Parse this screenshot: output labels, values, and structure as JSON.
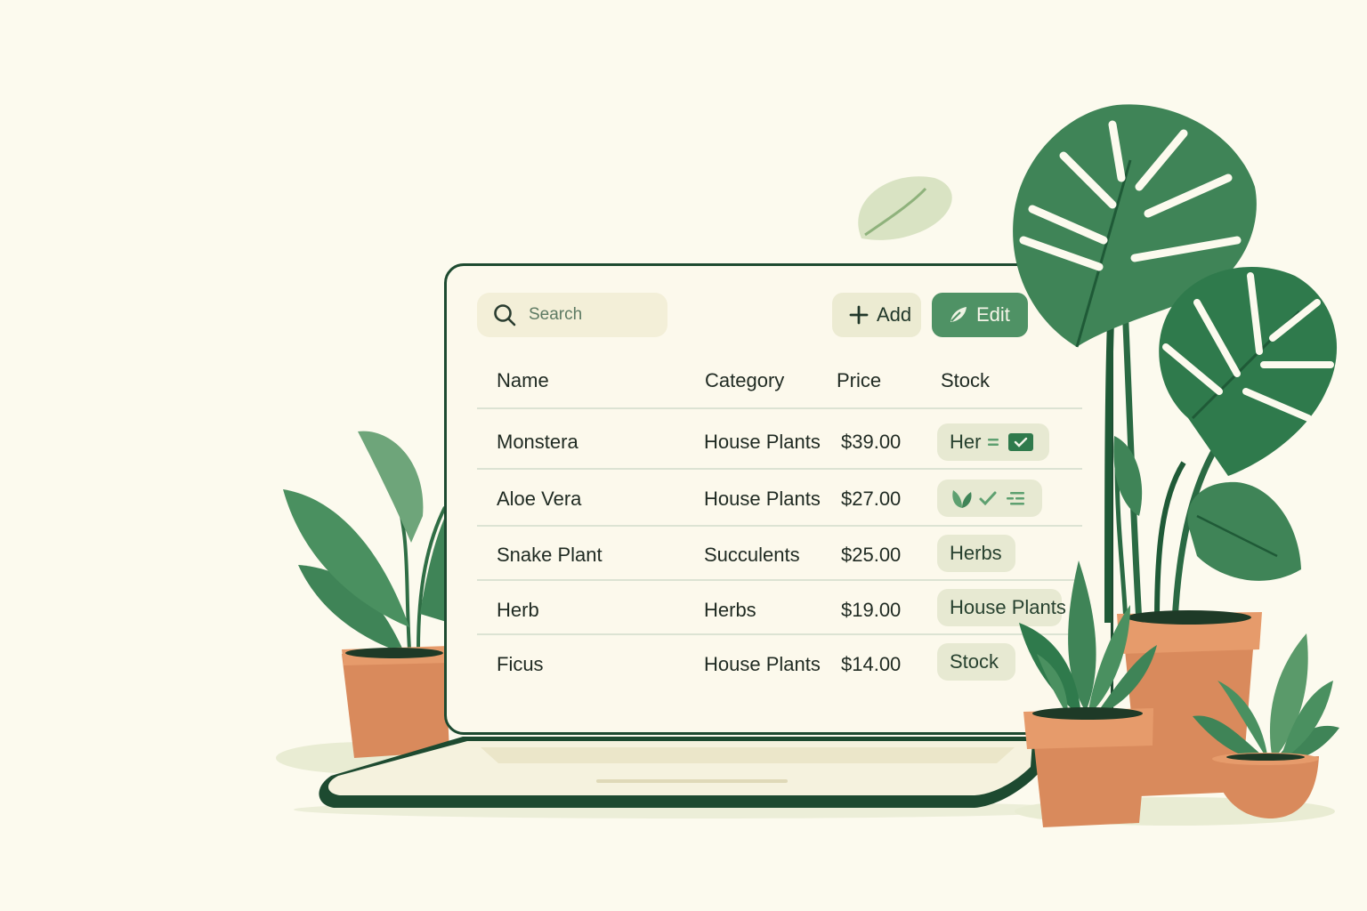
{
  "search": {
    "placeholder": "Search",
    "icon": "search-icon"
  },
  "toolbar": {
    "add_label": "Add",
    "edit_label": "Edit"
  },
  "table": {
    "columns": [
      "Name",
      "Category",
      "Price",
      "Stock"
    ],
    "rows": [
      {
        "name": "Monstera",
        "category": "House Plants",
        "price": "$39.00",
        "stock": "Her"
      },
      {
        "name": "Aloe Vera",
        "category": "House Plants",
        "price": "$27.00",
        "stock": ""
      },
      {
        "name": "Snake Plant",
        "category": "Succulents",
        "price": "$25.00",
        "stock": "Herbs"
      },
      {
        "name": "Herb",
        "category": "Herbs",
        "price": "$19.00",
        "stock": "House Plants"
      },
      {
        "name": "Ficus",
        "category": "House Plants",
        "price": "$14.00",
        "stock": "Stock"
      }
    ]
  },
  "colors": {
    "background": "#fcfaee",
    "accent": "#4f9265",
    "frame": "#1d4a30",
    "pot": "#d98a5c",
    "leaf": "#3f8457"
  }
}
